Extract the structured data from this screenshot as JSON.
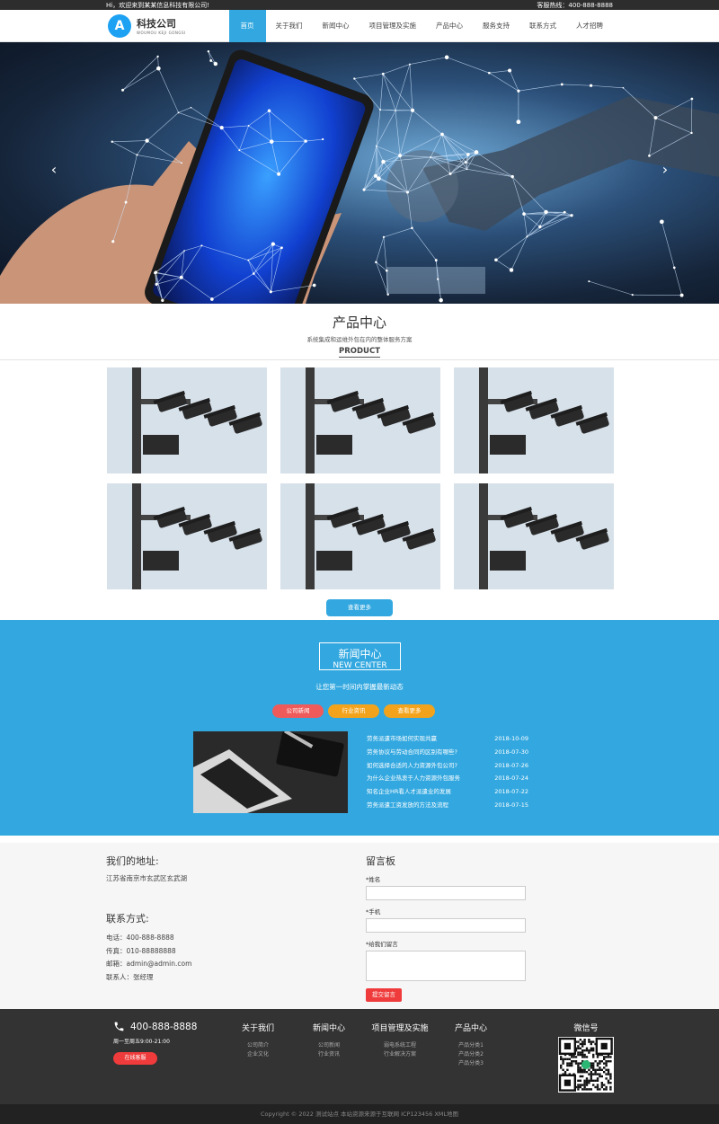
{
  "topbar": {
    "welcome": "Hi，欢迎来到某某信息科技有限公司!",
    "hotline_label": "客服热线：",
    "hotline": "400-888-8888"
  },
  "header": {
    "logo_cn": "科技公司",
    "logo_en": "WOUMOU KEJI GONGSI",
    "logo_letter": "A",
    "nav": [
      "首页",
      "关于我们",
      "新闻中心",
      "项目管理及实施",
      "产品中心",
      "服务支持",
      "联系方式",
      "人才招聘"
    ]
  },
  "banner": {
    "prev": "‹",
    "next": "›"
  },
  "products": {
    "title": "产品中心",
    "subtitle": "系统集成和运维外包在内的整体服务方案",
    "en": "PRODUCT",
    "more": "查看更多"
  },
  "news": {
    "title": "新闻中心",
    "en": "NEW CENTER",
    "subtitle": "让您第一时间内掌握最新动态",
    "tabs": [
      "公司新闻",
      "行业资讯",
      "查看更多"
    ],
    "items": [
      {
        "title": "劳务派遣市场如何实现共赢",
        "date": "2018-10-09"
      },
      {
        "title": "劳务协议与劳动合同的区别有哪些?",
        "date": "2018-07-30"
      },
      {
        "title": "如何选择合适的人力资源外包公司?",
        "date": "2018-07-26"
      },
      {
        "title": "为什么企业热衷于人力资源外包服务",
        "date": "2018-07-24"
      },
      {
        "title": "知名企业HR看人才派遣业的发展",
        "date": "2018-07-22"
      },
      {
        "title": "劳务派遣工资发放的方法及流程",
        "date": "2018-07-15"
      }
    ]
  },
  "contact": {
    "addr_title": "我们的地址:",
    "addr": "江苏省南京市玄武区玄武湖",
    "info_title": "联系方式:",
    "phone": "电话：400-888-8888",
    "fax": "传真：010-88888888",
    "email": "邮箱：admin@admin.com",
    "person": "联系人：张经理"
  },
  "message": {
    "title": "留言板",
    "name_label": "*姓名",
    "phone_label": "*手机",
    "msg_label": "*给我们留言",
    "submit": "提交留言"
  },
  "footer": {
    "phone": "400-888-8888",
    "hours": "周一至周五9:00-21:00",
    "online": "在线客服",
    "cols": [
      {
        "title": "关于我们",
        "items": [
          "公司简介",
          "企业文化"
        ]
      },
      {
        "title": "新闻中心",
        "items": [
          "公司新闻",
          "行业资讯"
        ]
      },
      {
        "title": "项目管理及实施",
        "items": [
          "弱电系统工程",
          "行业解决方案"
        ]
      },
      {
        "title": "产品中心",
        "items": [
          "产品分类1",
          "产品分类2",
          "产品分类3"
        ]
      }
    ],
    "wechat": "微信号"
  },
  "copyright": "Copyright © 2022 测试站点 本站资源来源于互联网  ICP123456  XML地图"
}
